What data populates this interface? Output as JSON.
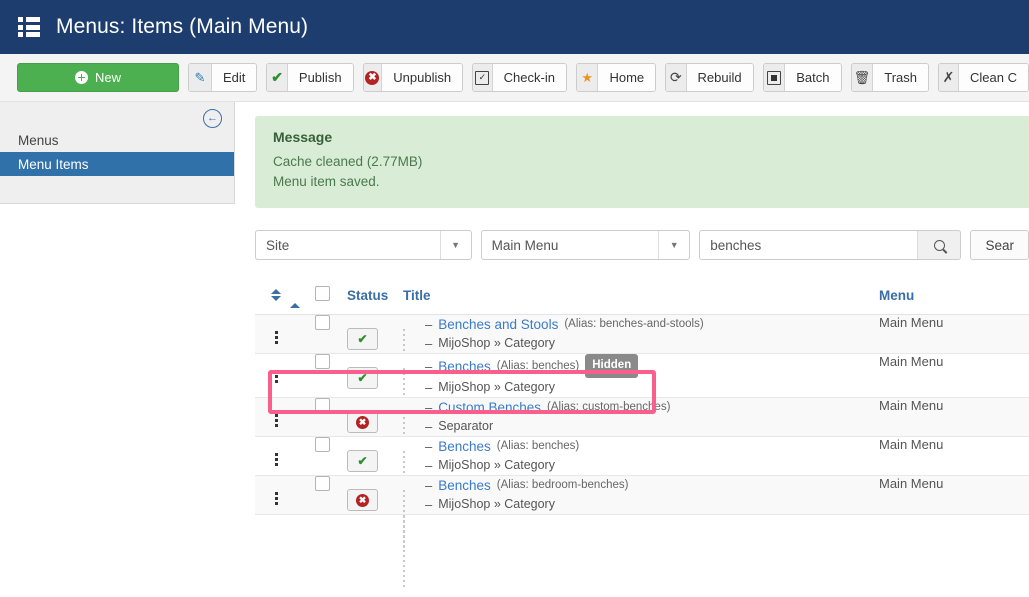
{
  "header": {
    "title": "Menus: Items (Main Menu)",
    "icon": "list-grid-icon",
    "bg_color": "#1c3d6e"
  },
  "toolbar": {
    "buttons": [
      {
        "label": "New",
        "icon": "plus-circle-icon",
        "style": "primary-green"
      },
      {
        "label": "Edit",
        "icon": "pencil-square-icon"
      },
      {
        "label": "Publish",
        "icon": "check-icon"
      },
      {
        "label": "Unpublish",
        "icon": "circle-x-icon"
      },
      {
        "label": "Check-in",
        "icon": "checkbox-icon"
      },
      {
        "label": "Home",
        "icon": "star-icon"
      },
      {
        "label": "Rebuild",
        "icon": "refresh-icon"
      },
      {
        "label": "Batch",
        "icon": "square-filled-icon"
      },
      {
        "label": "Trash",
        "icon": "trash-icon"
      },
      {
        "label": "Clean C",
        "icon": "broom-icon"
      }
    ]
  },
  "sidebar": {
    "collapse_icon": "arrow-left-circle-icon",
    "items": [
      {
        "label": "Menus",
        "active": false
      },
      {
        "label": "Menu Items",
        "active": true
      }
    ]
  },
  "message": {
    "title": "Message",
    "lines": [
      "Cache cleaned (2.77MB)",
      "Menu item saved."
    ],
    "bg_color": "#d9ecd5"
  },
  "filters": {
    "site_select": {
      "value": "Site"
    },
    "menu_select": {
      "value": "Main Menu"
    },
    "search": {
      "value": "benches",
      "placeholder": "Search",
      "icon": "magnifier-icon"
    },
    "search_tools_label": "Sear"
  },
  "table": {
    "columns": {
      "sort": "",
      "checkbox": "",
      "status": "Status",
      "title": "Title",
      "menu": "Menu"
    },
    "rows": [
      {
        "status": "published",
        "dash": "–",
        "title": "Benches and Stools",
        "alias": "(Alias: benches-and-stools)",
        "badge": "",
        "subdash": "–",
        "subtitle": "MijoShop » Category",
        "menu": "Main Menu",
        "highlighted": false
      },
      {
        "status": "published",
        "dash": "–",
        "title": "Benches",
        "alias": "(Alias: benches)",
        "badge": "Hidden",
        "subdash": "–",
        "subtitle": "MijoShop » Category",
        "menu": "Main Menu",
        "highlighted": true
      },
      {
        "status": "unpublished",
        "dash": "–",
        "title": "Custom Benches",
        "alias": "(Alias: custom-benches)",
        "badge": "",
        "subdash": "–",
        "subtitle": "Separator",
        "menu": "Main Menu",
        "highlighted": false
      },
      {
        "status": "published",
        "dash": "–",
        "title": "Benches",
        "alias": "(Alias: benches)",
        "badge": "",
        "subdash": "–",
        "subtitle": "MijoShop » Category",
        "menu": "Main Menu",
        "highlighted": false
      },
      {
        "status": "unpublished",
        "dash": "–",
        "title": "Benches",
        "alias": "(Alias: bedroom-benches)",
        "badge": "",
        "subdash": "–",
        "subtitle": "MijoShop » Category",
        "menu": "Main Menu",
        "highlighted": false
      }
    ]
  },
  "annotation": {
    "highlight_color": "#fa5e8c"
  }
}
